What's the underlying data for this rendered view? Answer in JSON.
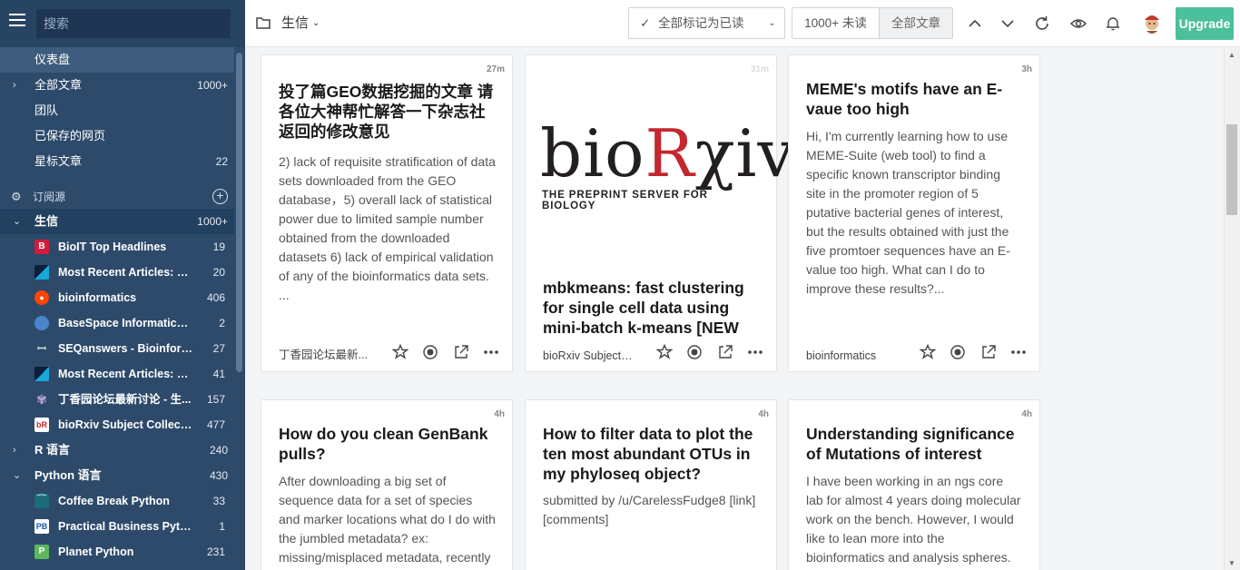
{
  "sidebar": {
    "search_placeholder": "搜索",
    "nav": [
      {
        "label": "仪表盘",
        "count": ""
      },
      {
        "label": "全部文章",
        "count": "1000+"
      },
      {
        "label": "团队",
        "count": ""
      },
      {
        "label": "已保存的网页",
        "count": ""
      },
      {
        "label": "星标文章",
        "count": "22"
      }
    ],
    "subs_label": "订阅源",
    "folders": [
      {
        "label": "生信",
        "count": "1000+"
      },
      {
        "label": "R 语言",
        "count": "240"
      },
      {
        "label": "Python 语言",
        "count": "430"
      }
    ],
    "feeds": [
      {
        "label": "BioIT Top Headlines",
        "count": "19",
        "icon": "B"
      },
      {
        "label": "Most Recent Articles: B...",
        "count": "20",
        "icon": ""
      },
      {
        "label": "bioinformatics",
        "count": "406",
        "icon": "reddit"
      },
      {
        "label": "BaseSpace Informatics ...",
        "count": "2",
        "icon": ""
      },
      {
        "label": "SEQanswers - Bioinform...",
        "count": "27",
        "icon": ""
      },
      {
        "label": "Most Recent Articles: B...",
        "count": "41",
        "icon": ""
      },
      {
        "label": "丁香园论坛最新讨论 - 生...",
        "count": "157",
        "icon": ""
      },
      {
        "label": "bioRxiv Subject Collecti...",
        "count": "477",
        "icon": "bR"
      },
      {
        "label": "Coffee Break Python",
        "count": "33",
        "icon": ""
      },
      {
        "label": "Practical Business Python",
        "count": "1",
        "icon": "PB"
      },
      {
        "label": "Planet Python",
        "count": "231",
        "icon": "P"
      }
    ]
  },
  "topbar": {
    "folder": "生信",
    "mark_all": "全部标记为已读",
    "unread": "1000+ 未读",
    "all_articles": "全部文章",
    "upgrade": "Upgrade"
  },
  "cards": [
    {
      "time": "27m",
      "title": "投了篇GEO数据挖掘的文章 请各位大神帮忙解答一下杂志社返回的修改意见",
      "body": "2) lack of requisite stratification of data sets downloaded from the GEO database，5) overall lack of statistical power due to limited sample number obtained from the downloaded datasets 6) lack of empirical validation of any of the bioinformatics data sets. ...",
      "source": "丁香园论坛最新..."
    },
    {
      "time": "31m",
      "title": "mbkmeans: fast clustering for single cell data using mini-batch k-means [NEW",
      "body": "",
      "source": "bioRxiv Subject ...",
      "logo_text_a": "bio",
      "logo_text_b": "R",
      "logo_text_c": "χiv",
      "logo_sub": "THE PREPRINT SERVER FOR BIOLOGY"
    },
    {
      "time": "3h",
      "title": "MEME's motifs have an E-vaue too high",
      "body": "Hi, I'm currently learning how to use MEME-Suite (web tool) to find a specific known transcriptor binding site in the promoter region of 5 putative bacterial genes of interest, but the results obtained with just the five promtoer sequences have an E-value too high. What can I do to improve these results?...",
      "source": "bioinformatics"
    },
    {
      "time": "4h",
      "title": "How do you clean GenBank pulls?",
      "body": "After downloading a big set of sequence data for a set of species and marker locations what do I do with the jumbled metadata? ex: missing/misplaced metadata, recently",
      "source": ""
    },
    {
      "time": "4h",
      "title": "How to filter data to plot the ten most abundant OTUs in my phyloseq object?",
      "body": "submitted by /u/CarelessFudge8 [link] [comments]",
      "source": ""
    },
    {
      "time": "4h",
      "title": "Understanding significance of Mutations of interest",
      "body": "I have been working in an ngs core lab for almost 4 years doing molecular work on the bench. However, I would like to lean more into the bioinformatics and analysis spheres.",
      "source": ""
    }
  ]
}
